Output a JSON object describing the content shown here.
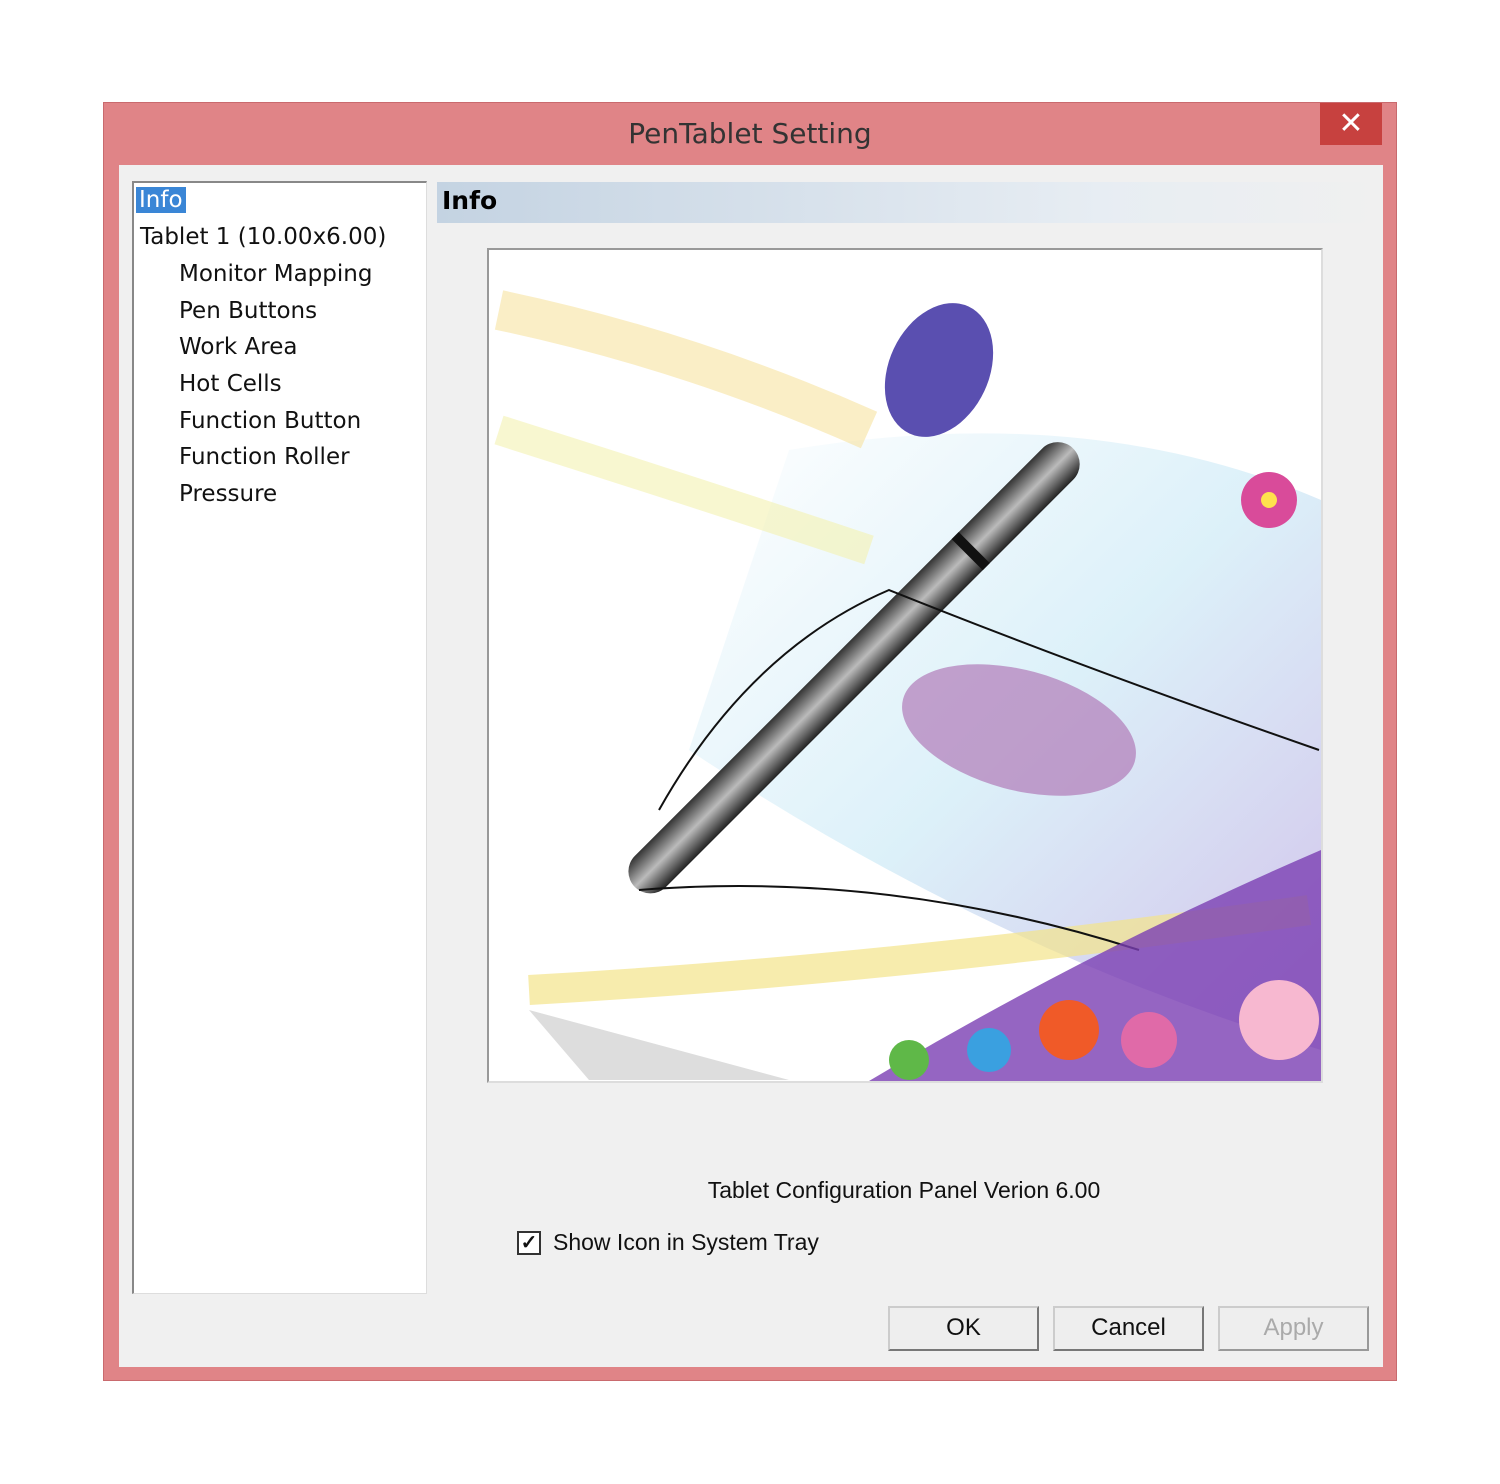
{
  "window": {
    "title": "PenTablet Setting",
    "close_icon": "close-icon",
    "accent": "#e08487"
  },
  "tree": {
    "items": [
      {
        "label": "Info",
        "selected": true
      },
      {
        "label": "Tablet  1 (10.00x6.00)"
      },
      {
        "label": "Monitor Mapping"
      },
      {
        "label": "Pen Buttons"
      },
      {
        "label": "Work Area"
      },
      {
        "label": "Hot Cells"
      },
      {
        "label": "Function Button"
      },
      {
        "label": "Function Roller"
      },
      {
        "label": "Pressure"
      }
    ]
  },
  "panel": {
    "header": "Info",
    "version": "Tablet Configuration Panel Verion 6.00",
    "show_tray": {
      "label": "Show Icon in System Tray",
      "checked": true
    }
  },
  "buttons": {
    "ok": "OK",
    "cancel": "Cancel",
    "apply": "Apply"
  }
}
